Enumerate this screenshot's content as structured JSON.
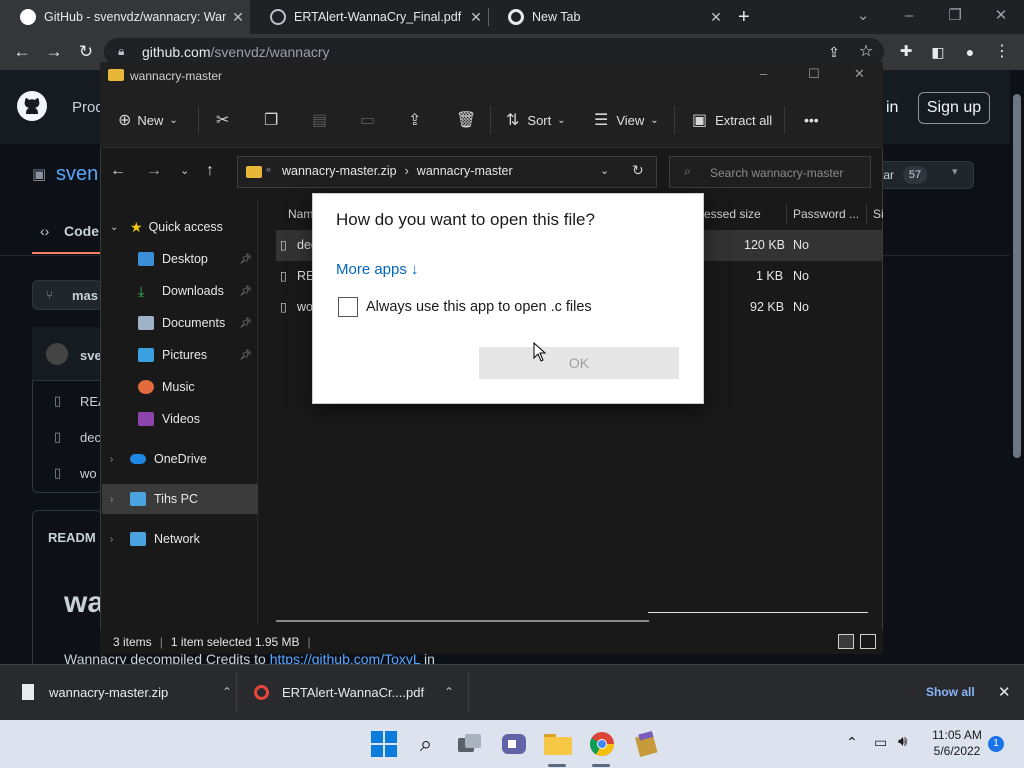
{
  "chrome": {
    "tabs": [
      {
        "title": "GitHub - svenvdz/wannacry: Wan"
      },
      {
        "title": "ERTAlert-WannaCry_Final.pdf"
      },
      {
        "title": "New Tab"
      }
    ],
    "url_host": "github.com",
    "url_path": "/svenvdz/wannacry"
  },
  "github": {
    "header_nav_partial": "Prod",
    "signin_partial": "in",
    "signup_label": "Sign up",
    "repo_owner_partial": "sven",
    "tab_code": "Code",
    "branch_partial": "mas",
    "star_partial": "tar",
    "star_count": "57",
    "commit_user_partial": "sve",
    "files_partial": [
      "REA",
      "dec",
      "wo"
    ],
    "readme_partial": "READM",
    "readme_heading_partial": "wa",
    "readme_text_prefix": "Wannacry decompiled Credits to",
    "readme_link": "https://github.com/ToxyL",
    "readme_text_suffix": " in"
  },
  "explorer": {
    "window_title": "wannacry-master",
    "commands": {
      "new": "New",
      "sort": "Sort",
      "view": "View",
      "extract_all": "Extract all",
      "more": "•••"
    },
    "breadcrumb": [
      "wannacry-master.zip",
      "wannacry-master"
    ],
    "search_placeholder": "Search wannacry-master",
    "nav": {
      "quick_access": "Quick access",
      "items": [
        {
          "label": "Desktop"
        },
        {
          "label": "Downloads"
        },
        {
          "label": "Documents"
        },
        {
          "label": "Pictures"
        },
        {
          "label": "Music"
        },
        {
          "label": "Videos"
        }
      ],
      "onedrive": "OneDrive",
      "this_pc": "Tihs PC",
      "network": "Network"
    },
    "columns": {
      "name": "Nam",
      "compressed": "essed size",
      "password": "Password ...",
      "size": "Si"
    },
    "files": [
      {
        "name": "dec",
        "compressed": "120 KB",
        "password": "No"
      },
      {
        "name": "REA",
        "compressed": "1 KB",
        "password": "No"
      },
      {
        "name": "wo",
        "compressed": "92 KB",
        "password": "No"
      }
    ],
    "status": {
      "count": "3 items",
      "selection": "1 item selected  1.95 MB"
    }
  },
  "dialog": {
    "title": "How do you want to open this file?",
    "more_apps": "More apps ↓",
    "checkbox_label": "Always use this app to open .c files",
    "ok_label": "OK"
  },
  "downloads": {
    "items": [
      {
        "name": "wannacry-master.zip"
      },
      {
        "name": "ERTAlert-WannaCr....pdf"
      }
    ],
    "show_all": "Show all"
  },
  "taskbar": {
    "time": "11:05 AM",
    "date": "5/6/2022",
    "notifications": "1"
  },
  "colors": {
    "accent_blue": "#0067c0",
    "explorer_bg": "#191919",
    "dialog_bg": "#ffffff",
    "taskbar_bg": "#dde3ee"
  }
}
